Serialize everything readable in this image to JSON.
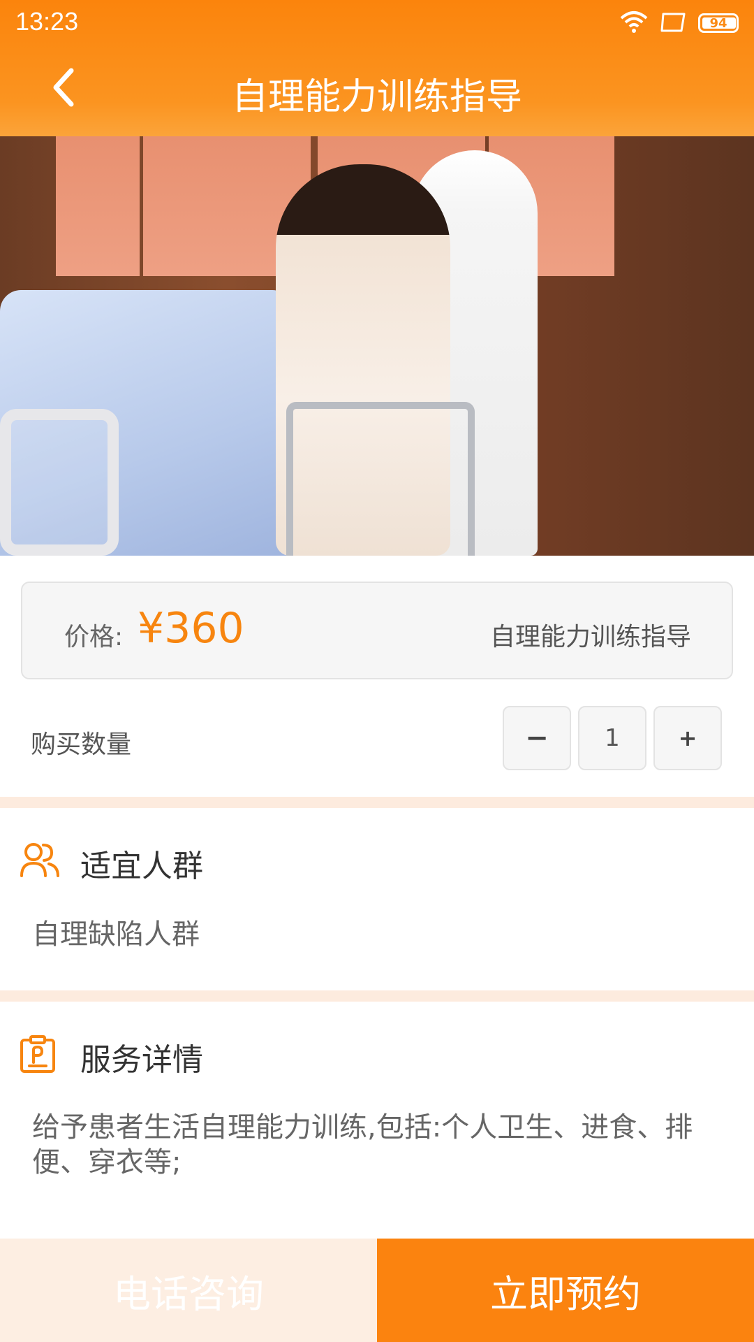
{
  "status_bar": {
    "time": "13:23",
    "battery": "94",
    "icons": [
      "wifi-icon",
      "screen-icon",
      "battery-icon"
    ]
  },
  "header": {
    "title": "自理能力训练指导",
    "back_icon": "chevron-left-icon"
  },
  "hero": {
    "image_description": "photo"
  },
  "price": {
    "label": "价格:",
    "value": "¥360",
    "service_name": "自理能力训练指导"
  },
  "quantity": {
    "label": "购买数量",
    "minus": "−",
    "value": "1",
    "plus": "+"
  },
  "suitable": {
    "title": "适宜人群",
    "text": "自理缺陷人群",
    "icon": "people-icon"
  },
  "details": {
    "title": "服务详情",
    "text": "给予患者生活自理能力训练,包括:个人卫生、进食、排便、穿衣等;",
    "icon": "badge-icon"
  },
  "bottom": {
    "call_label": "电话咨询",
    "book_label": "立即预约"
  },
  "colors": {
    "accent": "#fb830f",
    "divider": "#fdebde",
    "call_bg": "#fdeee2"
  }
}
